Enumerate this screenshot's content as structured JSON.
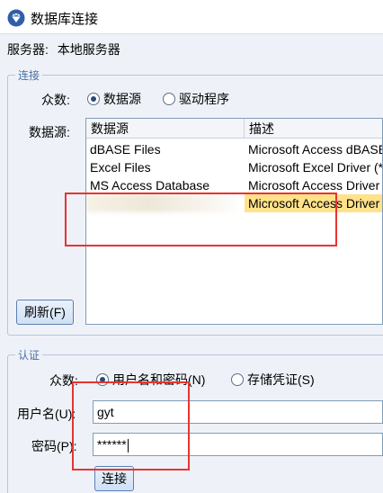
{
  "window": {
    "title": "数据库连接",
    "icon": "gem-icon"
  },
  "server": {
    "label": "服务器:",
    "value": "本地服务器"
  },
  "connection": {
    "legend": "连接",
    "mode_label": "众数:",
    "radio_datasource": "数据源",
    "radio_driver": "驱动程序",
    "selected": "datasource",
    "datasource_label": "数据源:",
    "columns": [
      "数据源",
      "描述"
    ],
    "rows": [
      [
        "dBASE Files",
        "Microsoft Access dBASE Driver"
      ],
      [
        "Excel Files",
        "Microsoft Excel Driver (*.xls)"
      ],
      [
        "MS Access Database",
        "Microsoft Access Driver (*.mdb)"
      ],
      [
        "",
        "Microsoft Access Driver (*.mdb)"
      ]
    ],
    "refresh_button": "刷新(F)"
  },
  "auth": {
    "legend": "认证",
    "mode_label": "众数:",
    "radio_userpass": "用户名和密码(N)",
    "radio_stored": "存储凭证(S)",
    "selected": "userpass",
    "username_label": "用户名(U):",
    "username_value": "gyt",
    "password_label": "密码(P):",
    "password_value": "******",
    "connect_button": "连接"
  },
  "colors": {
    "highlight": "#ffe28a",
    "annotation": "#e8342f",
    "legend": "#4a6ea9"
  }
}
